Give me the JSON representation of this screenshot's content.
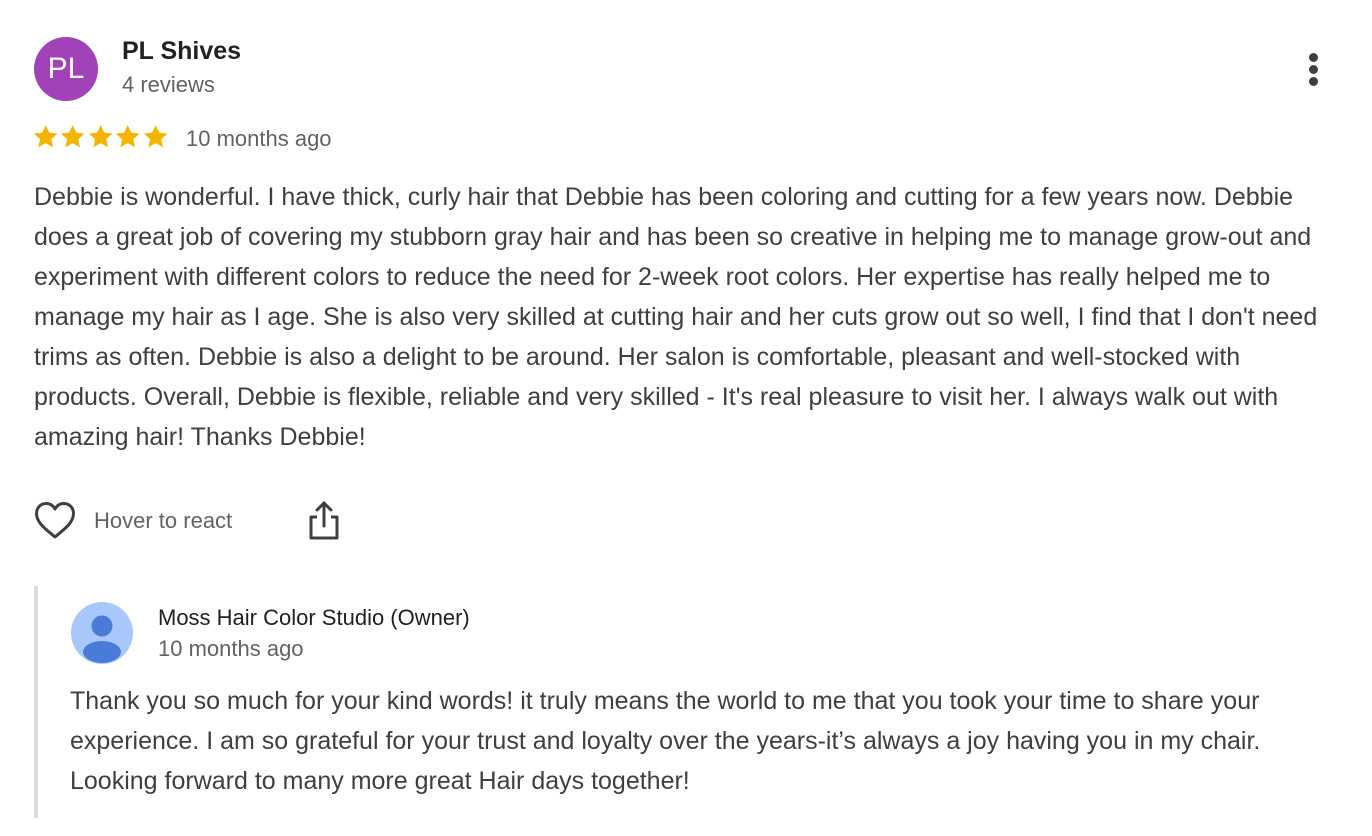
{
  "review": {
    "avatar_initials": "PL",
    "avatar_color": "#a142b9",
    "author_name": "PL Shives",
    "author_meta": "4 reviews",
    "rating": 5,
    "rating_max": 5,
    "star_color": "#f4b400",
    "date": "10 months ago",
    "text": "Debbie is wonderful. I have thick, curly hair that Debbie has been coloring and cutting for a few years now. Debbie does a great job of covering my stubborn gray hair and has been so creative in helping me to manage grow-out and experiment with different colors to reduce the need for 2-week root colors. Her expertise has really helped me to manage my hair as I age. She is also very skilled at cutting hair and her cuts grow out so well, I find that I don't need trims as often. Debbie is also a delight to be around. Her salon is comfortable, pleasant and well-stocked with products. Overall, Debbie is flexible, reliable and very skilled - It's real pleasure to visit her. I always walk out with amazing hair! Thanks Debbie!",
    "more_icon": "more-vertical-icon"
  },
  "actions": {
    "react_icon": "heart-outline-icon",
    "react_label": "Hover to react",
    "share_icon": "share-icon"
  },
  "owner_response": {
    "avatar_icon": "default-person-avatar-icon",
    "name": "Moss Hair Color Studio (Owner)",
    "date": "10 months ago",
    "text": "Thank you so much for your kind words! it truly means the world to me that you took your time to share your experience. I am so grateful for your trust and loyalty over the years-it’s always a joy having you in my chair. Looking forward to many more great Hair days together!"
  }
}
